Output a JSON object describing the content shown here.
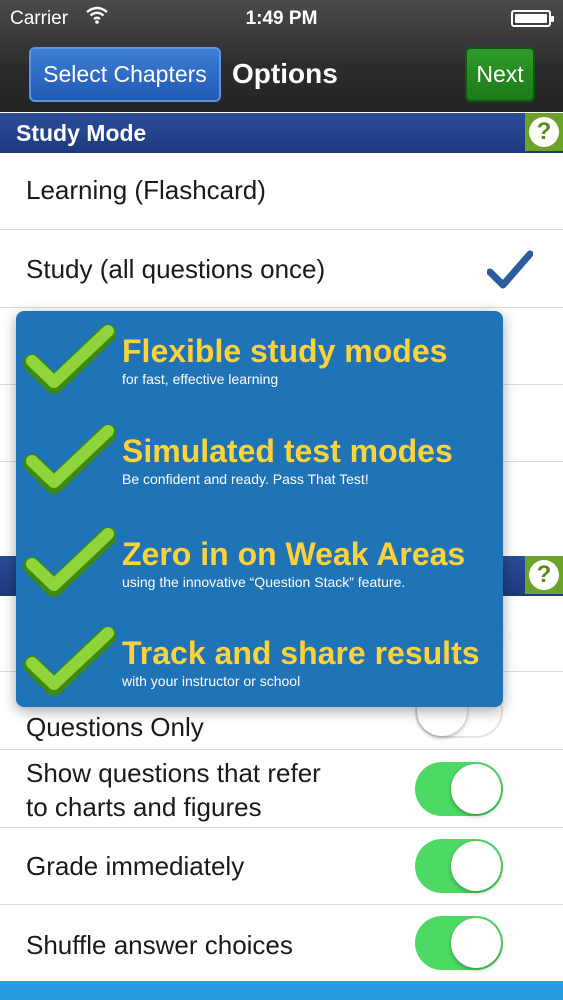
{
  "status_bar": {
    "carrier": "Carrier",
    "time": "1:49 PM",
    "battery_level": 1.0
  },
  "nav": {
    "back_label": "Select Chapters",
    "title": "Options",
    "next_label": "Next"
  },
  "study_mode": {
    "header": "Study Mode",
    "help_label": "?",
    "items": [
      {
        "label": "Learning (Flashcard)",
        "selected": false
      },
      {
        "label": "Study (all questions once)",
        "selected": true
      }
    ]
  },
  "section2": {
    "help_label": "?"
  },
  "settings": [
    {
      "label": "Questions Only",
      "on": false
    },
    {
      "label_line1": "Show questions that refer",
      "label_line2": "to charts and figures",
      "on": true
    },
    {
      "label": "Grade immediately",
      "on": true
    },
    {
      "label": "Shuffle answer choices",
      "on": true
    }
  ],
  "promo": {
    "features": [
      {
        "title": "Flexible study modes",
        "subtitle": "for fast, effective learning"
      },
      {
        "title": "Simulated test modes",
        "subtitle": "Be confident and ready.  Pass That Test!"
      },
      {
        "title": "Zero in on Weak Areas",
        "subtitle": "using the innovative “Question Stack” feature."
      },
      {
        "title": "Track and share results",
        "subtitle": "with your instructor or school"
      }
    ]
  },
  "colors": {
    "section_bar": "#1c3a7e",
    "promo_bg": "#1f73b7",
    "promo_title": "#ffd23a",
    "toggle_on": "#4cd964",
    "check": "#2a5d9e",
    "next_button": "#1b7a18",
    "back_button": "#2459b3"
  },
  "icons": {
    "wifi": "wifi-icon",
    "battery": "battery-icon",
    "check": "checkmark-icon",
    "feature_check": "green-checkmark-icon",
    "help": "help-icon"
  }
}
